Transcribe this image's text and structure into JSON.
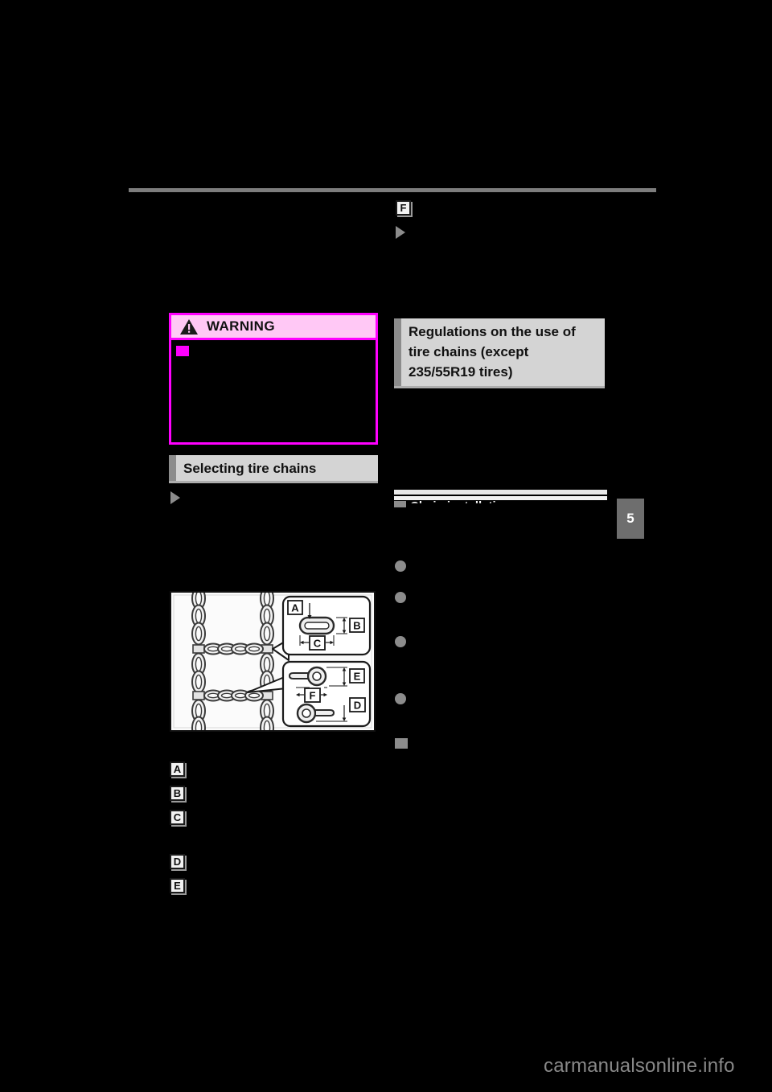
{
  "page": {
    "number": "5",
    "watermark": "carmanualsonline.info",
    "background_color": "#000000"
  },
  "warning": {
    "title": "WARNING",
    "icon": "warning-triangle-icon",
    "border_color": "#ff00ff",
    "header_color": "#ffc8f5",
    "bullet_color": "#ff00ff",
    "body_text": ""
  },
  "headings": {
    "selecting_tire_chains": "Selecting tire chains",
    "regulations": "Regulations on the use of tire chains (except 235/55R19 tires)",
    "subsection_chain_installation": "Chain installation",
    "accent_color": "#8c8c8c",
    "background_color": "#d4d4d4"
  },
  "left_column": {
    "triangle_marker": "▶",
    "letter_markers": [
      {
        "letter": "A",
        "text": ""
      },
      {
        "letter": "B",
        "text": ""
      },
      {
        "letter": "C",
        "text": ""
      },
      {
        "letter": "D",
        "text": ""
      },
      {
        "letter": "E",
        "text": ""
      }
    ]
  },
  "right_column": {
    "letter_marker_f": "F",
    "triangle_marker": "▶",
    "bullets": [
      "",
      "",
      "",
      ""
    ],
    "square_bullet": ""
  },
  "figure": {
    "caption": "",
    "callout_labels": [
      "A",
      "B",
      "C",
      "D",
      "E",
      "F"
    ],
    "description": "tire-chain-dimensions-diagram"
  }
}
